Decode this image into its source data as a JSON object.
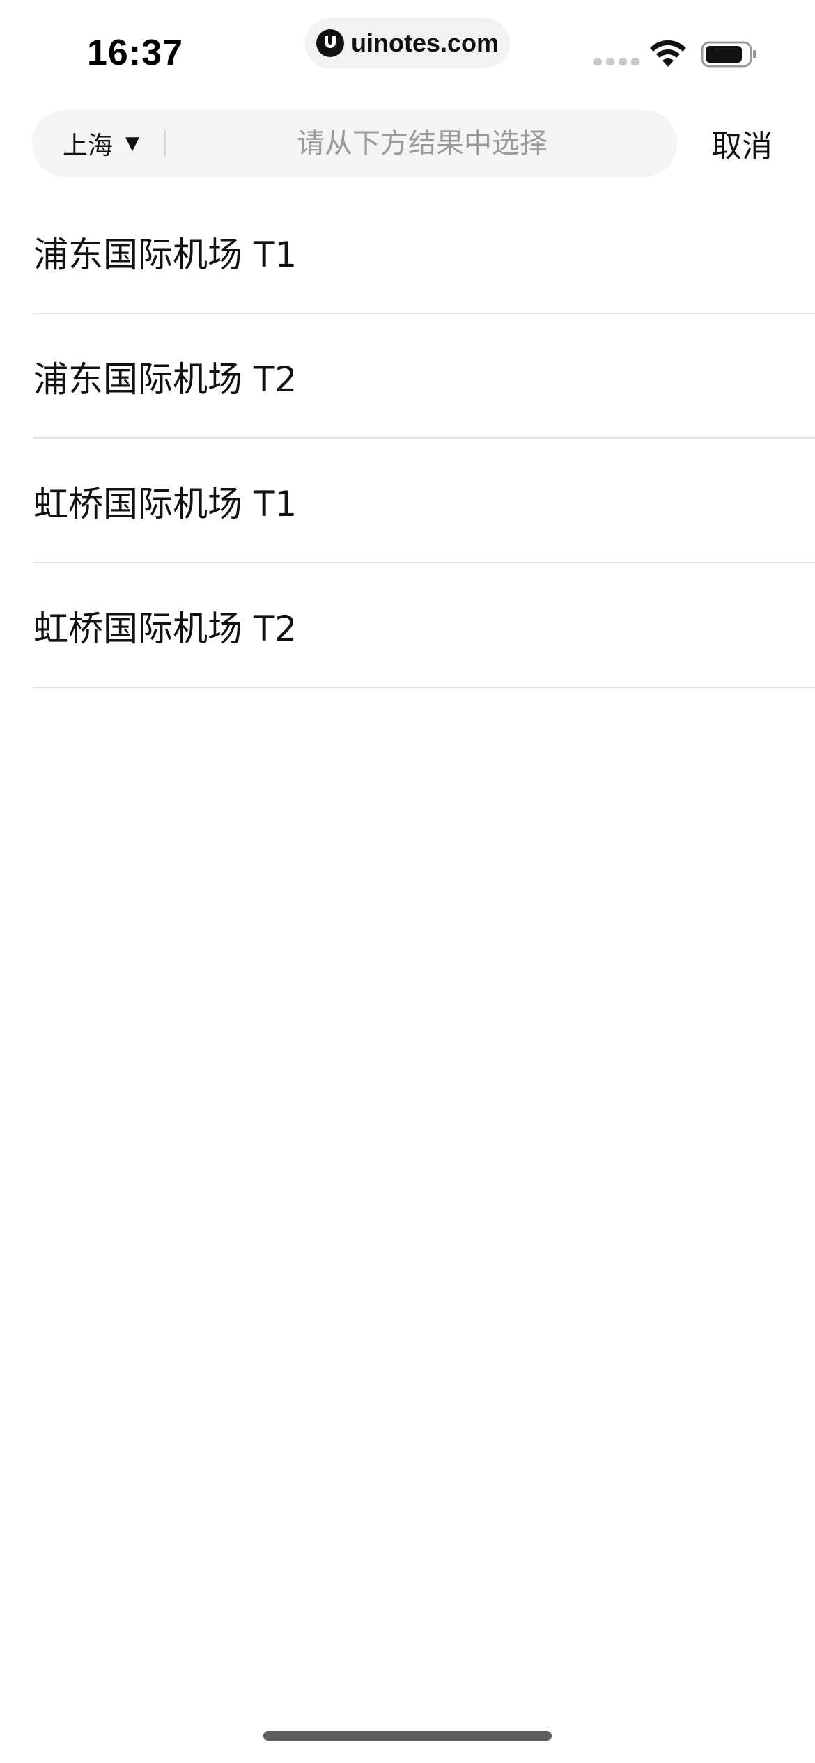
{
  "status_bar": {
    "time": "16:37",
    "url": "uinotes.com",
    "icons": [
      "logo-icon",
      "signal-icon",
      "wifi-icon",
      "battery-icon"
    ]
  },
  "search": {
    "city": "上海",
    "caret": "▼",
    "placeholder": "请从下方结果中选择",
    "value": "",
    "cancel_label": "取消"
  },
  "results": [
    {
      "label": "浦东国际机场 T1"
    },
    {
      "label": "浦东国际机场 T2"
    },
    {
      "label": "虹桥国际机场 T1"
    },
    {
      "label": "虹桥国际机场 T2"
    }
  ],
  "colors": {
    "search_background": "#f4f4f4",
    "placeholder": "#9a9a9a",
    "divider": "#e2e2e2",
    "text": "#111111"
  }
}
